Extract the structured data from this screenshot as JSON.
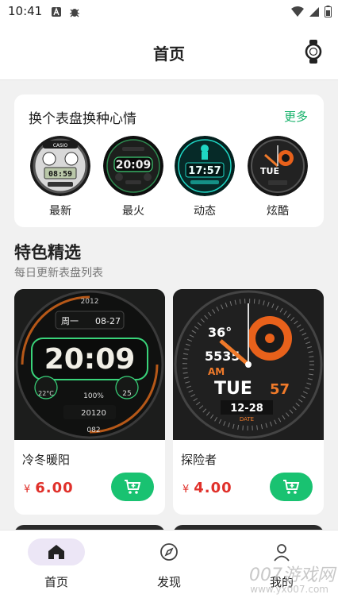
{
  "status": {
    "time": "10:41"
  },
  "header": {
    "title": "首页"
  },
  "switch_card": {
    "title": "换个表盘换种心情",
    "more": "更多",
    "faces": [
      {
        "label": "最新",
        "face_text": "08:59",
        "brand": "CASIO"
      },
      {
        "label": "最火",
        "face_text": "20:09"
      },
      {
        "label": "动态",
        "face_text": "17:57"
      },
      {
        "label": "炫酷",
        "face_text": "TUE"
      }
    ]
  },
  "featured": {
    "title": "特色精选",
    "subtitle": "每日更新表盘列表"
  },
  "products": [
    {
      "name": "冷冬暖阳",
      "currency": "¥",
      "price": "6.00",
      "face": {
        "year": "2012",
        "weekday": "周一",
        "date": "08-27",
        "time": "20:09",
        "temp": "22°C",
        "battery": "100%",
        "moon": "25",
        "steps": "20120",
        "heart": "082"
      }
    },
    {
      "name": "探险者",
      "currency": "¥",
      "price": "4.00",
      "face": {
        "temp": "36°",
        "steps": "5535",
        "ampm": "AM",
        "day": "TUE",
        "sec": "57",
        "date": "12-28",
        "date_label": "DATE"
      }
    }
  ],
  "nav": [
    {
      "label": "首页",
      "icon": "home-icon",
      "active": true
    },
    {
      "label": "发现",
      "icon": "compass-icon",
      "active": false
    },
    {
      "label": "我的",
      "icon": "user-icon",
      "active": false
    }
  ],
  "watermark": {
    "main": "007游戏网",
    "url": "www.yx007.com"
  },
  "colors": {
    "accent": "#18b26b",
    "price": "#e0302a",
    "nav_active": "#ece6f6"
  }
}
